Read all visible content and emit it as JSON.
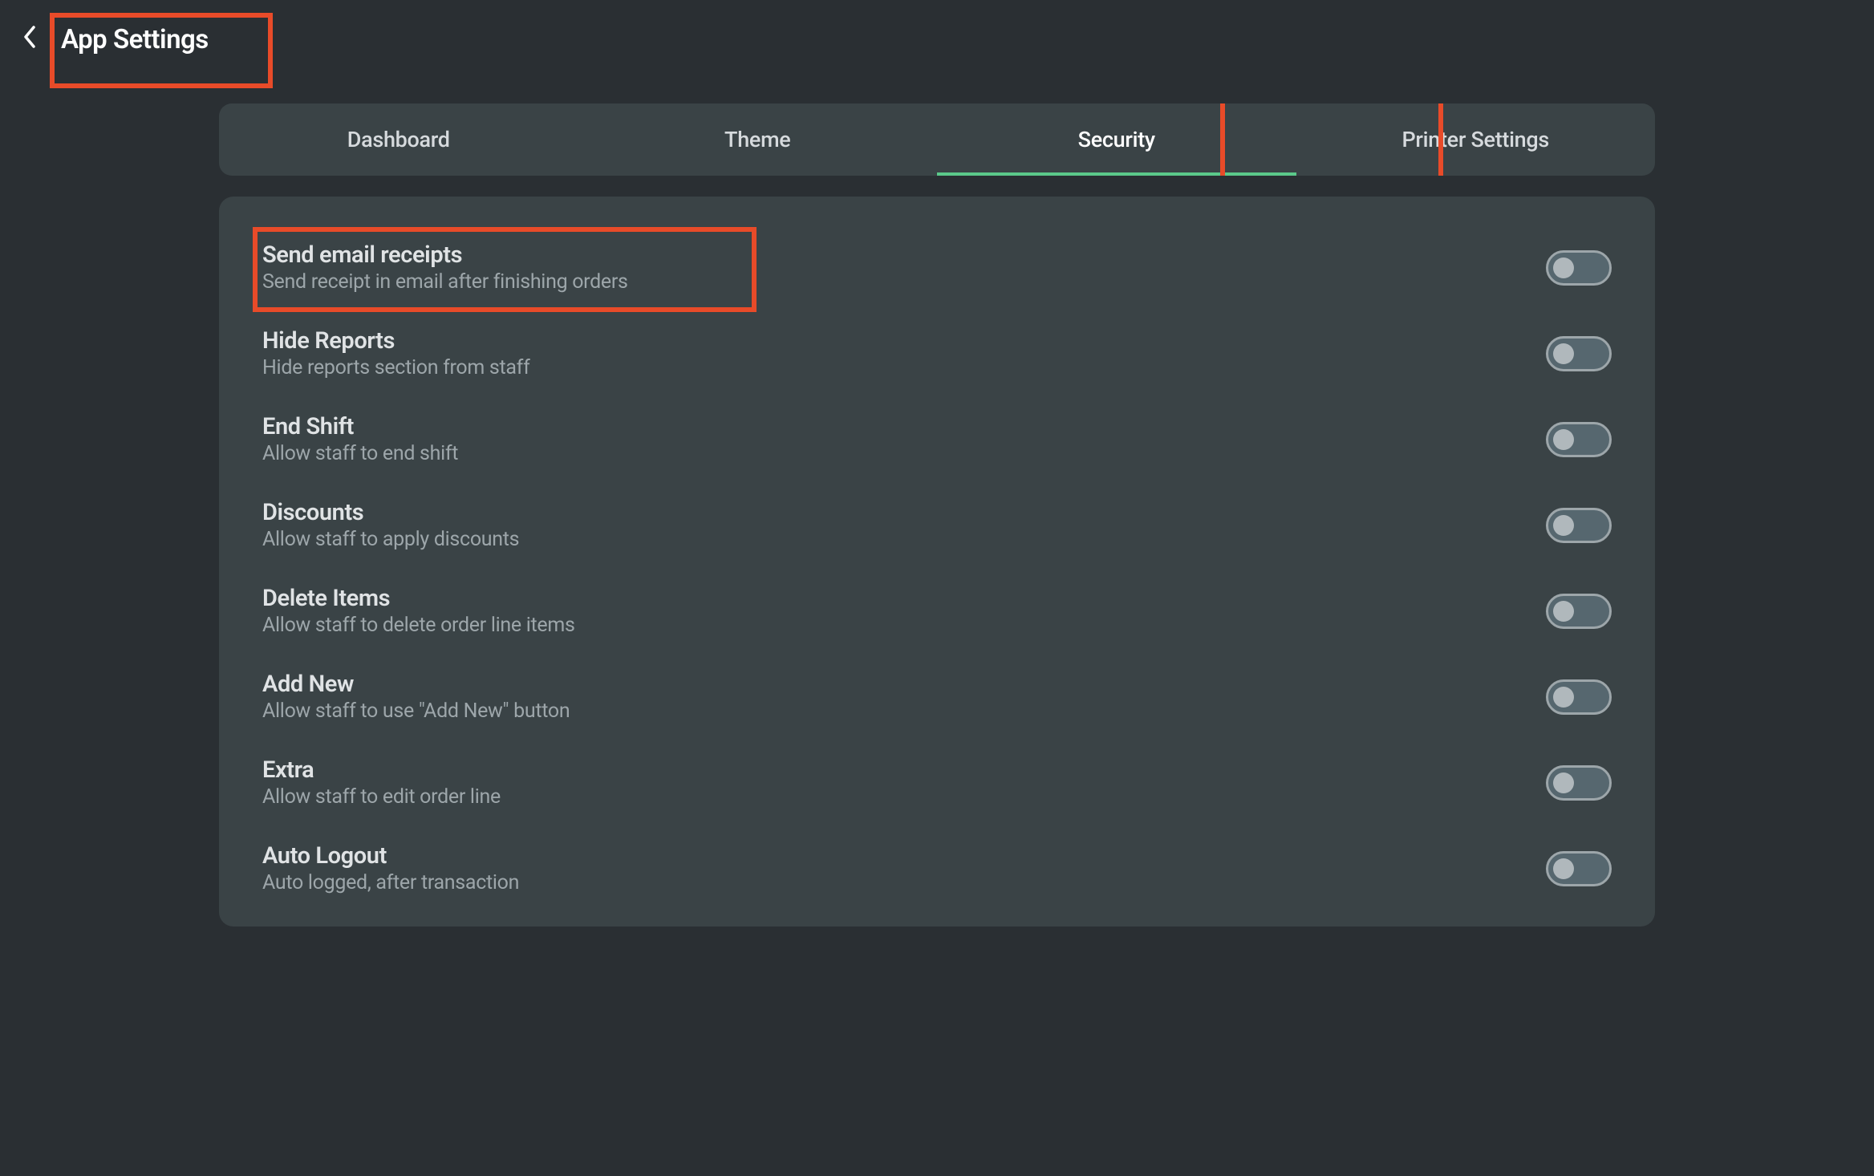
{
  "header": {
    "title": "App Settings"
  },
  "tabs": [
    {
      "label": "Dashboard",
      "active": false
    },
    {
      "label": "Theme",
      "active": false
    },
    {
      "label": "Security",
      "active": true
    },
    {
      "label": "Printer Settings",
      "active": false
    }
  ],
  "settings": [
    {
      "title": "Send email receipts",
      "description": "Send receipt in email after finishing orders",
      "enabled": false,
      "highlighted": true
    },
    {
      "title": "Hide Reports",
      "description": "Hide reports section from staff",
      "enabled": false,
      "highlighted": false
    },
    {
      "title": "End Shift",
      "description": "Allow staff to end shift",
      "enabled": false,
      "highlighted": false
    },
    {
      "title": "Discounts",
      "description": "Allow staff to apply discounts",
      "enabled": false,
      "highlighted": false
    },
    {
      "title": "Delete Items",
      "description": "Allow staff to delete order line items",
      "enabled": false,
      "highlighted": false
    },
    {
      "title": "Add New",
      "description": "Allow staff to use \"Add New\" button",
      "enabled": false,
      "highlighted": false
    },
    {
      "title": "Extra",
      "description": "Allow staff to edit order line",
      "enabled": false,
      "highlighted": false
    },
    {
      "title": "Auto Logout",
      "description": "Auto logged, after transaction",
      "enabled": false,
      "highlighted": false
    }
  ],
  "highlights": {
    "title_box": true,
    "security_tab_box": true
  }
}
